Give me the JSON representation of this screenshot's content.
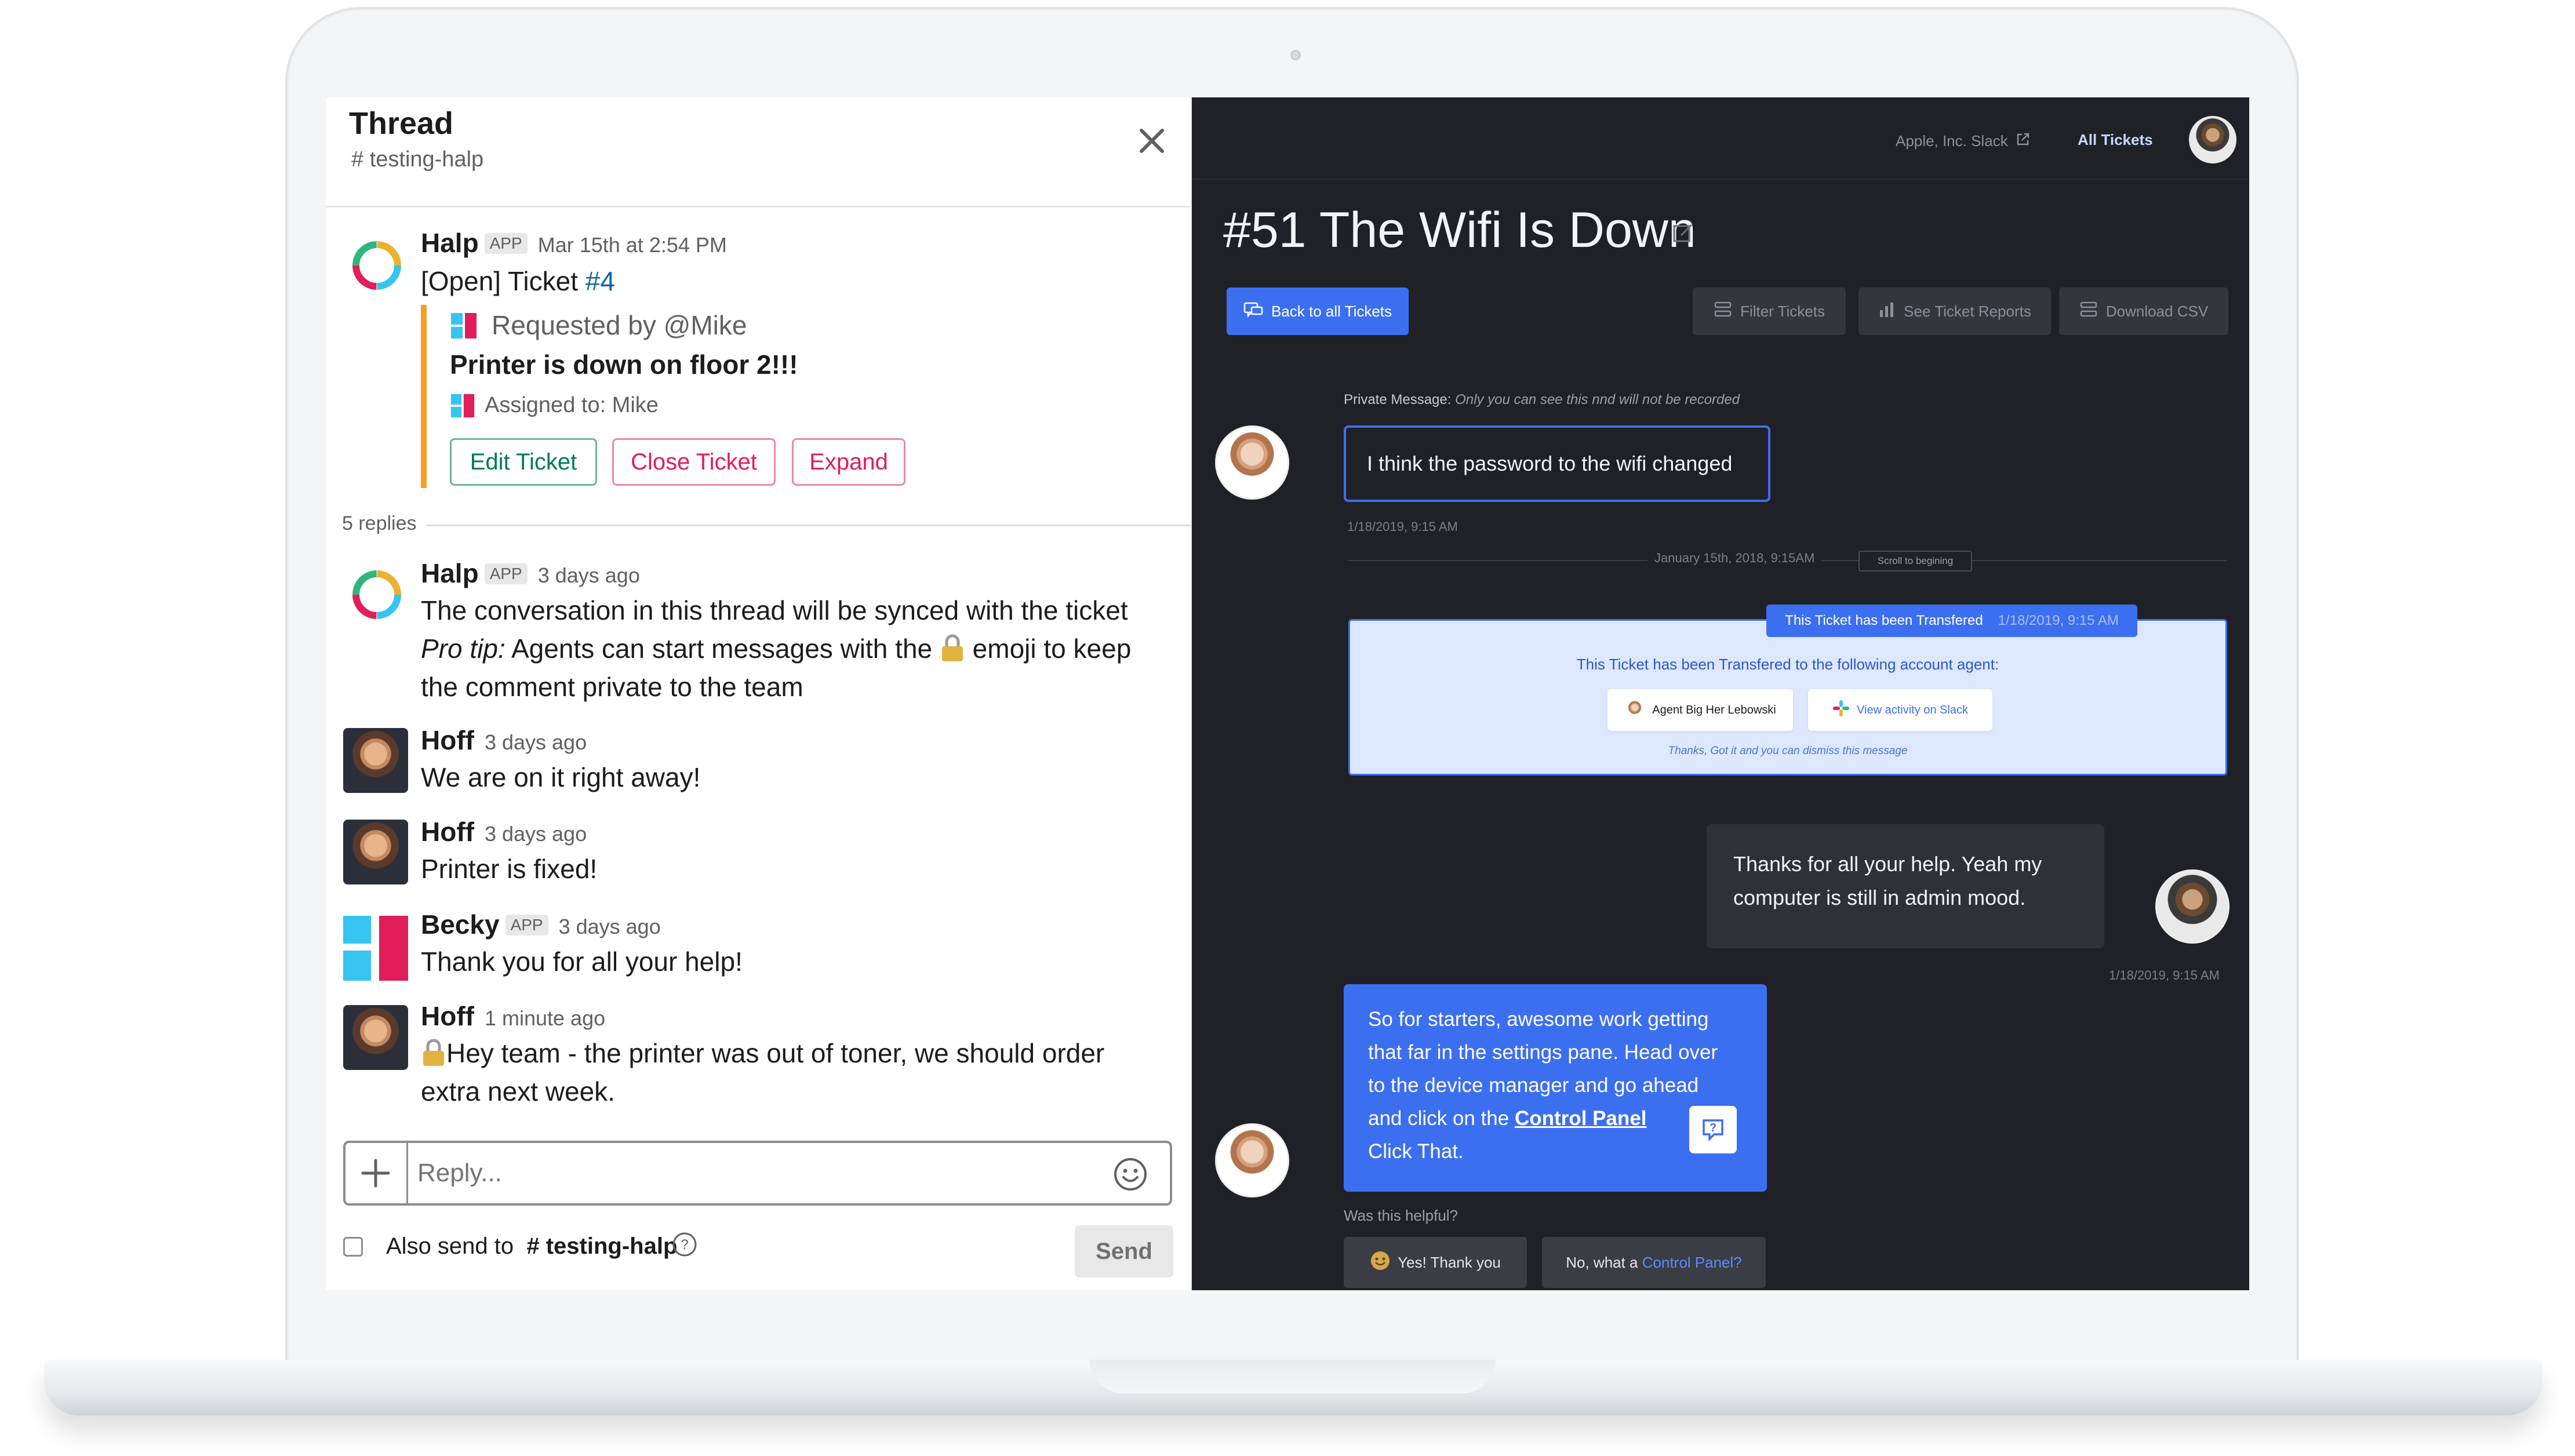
{
  "thread": {
    "title": "Thread",
    "channel": "# testing-halp",
    "parent": {
      "name": "Halp",
      "badge": "APP",
      "time": "Mar 15th at 2:54 PM",
      "line_prefix": "[Open] Ticket ",
      "ticket_link": "#4",
      "requested_by": "Requested by @Mike",
      "subject": "Printer is down on floor 2!!!",
      "assigned_to": "Assigned to: Mike",
      "buttons": {
        "edit": "Edit Ticket",
        "close": "Close Ticket",
        "expand": "Expand"
      }
    },
    "replies_count": "5 replies",
    "messages": [
      {
        "name": "Halp",
        "badge": "APP",
        "time": "3 days ago"
      },
      {
        "name": "Hoff",
        "time": "3 days ago",
        "text": "We are on it right away!"
      },
      {
        "name": "Hoff",
        "time": "3 days ago",
        "text": "Printer is fixed!"
      },
      {
        "name": "Becky",
        "badge": "APP",
        "time": "3 days ago",
        "text": "Thank you for all your help!"
      },
      {
        "name": "Hoff",
        "time": "1 minute ago",
        "line1": "Hey team - the printer was out of toner, we should order",
        "line2": "extra next week."
      }
    ],
    "halp_msg": {
      "line1": "The conversation in this thread will be synced with the ticket",
      "tip_label": "Pro tip:",
      "line2_a": " Agents can start messages with the ",
      "line2_b": " emoji to keep",
      "line3": "the comment private to the team"
    },
    "reply_placeholder": "Reply...",
    "also_send_label": "Also send to",
    "also_send_channel": "# testing-halp",
    "send_label": "Send"
  },
  "ticket": {
    "workspace_link": "Apple, Inc. Slack",
    "all_tickets": "All Tickets",
    "title": "#51 The Wifi Is Down",
    "back_button": "Back to all Tickets",
    "filter_button": "Filter Tickets",
    "reports_button": "See Ticket Reports",
    "csv_button": "Download CSV",
    "private_label": "Private Message:",
    "private_note": "Only you can see this nnd will not be recorded",
    "msg1": "I think the password to the wifi changed",
    "msg1_time": "1/18/2019, 9:15 AM",
    "divider_date": "January 15th, 2018, 9:15AM",
    "scroll_label": "Scroll to begining",
    "transfer_tab_label": "This Ticket has been Transfered",
    "transfer_tab_time": "1/18/2019, 9:15 AM",
    "transfer_text": "This Ticket has been Transfered to the following account agent:",
    "agent_chip": "Agent Big Her Lebowski",
    "slack_chip": "View activity on Slack",
    "dismiss_text": "Thanks, Got it and you can dismiss this message",
    "msg2_line1": "Thanks for all your help. Yeah my",
    "msg2_line2": "computer is still in admin mood.",
    "msg2_time": "1/18/2019, 9:15 AM",
    "msg3_line1": "So for starters, awesome work getting",
    "msg3_line2": "that far in the settings pane. Head over",
    "msg3_line3": "to the device manager and go ahead",
    "msg3_line4_a": "and click on the ",
    "msg3_link": "Control Panel",
    "msg3_line5": "Click That.",
    "helpful_q": "Was this helpful?",
    "yes_button": "Yes! Thank you",
    "no_button_a": "No, what a ",
    "no_button_link": "Control Panel?"
  },
  "colors": {
    "slack_green": "#007a5a",
    "slack_red": "#e01e5a",
    "halp_orange": "#f59f29",
    "accent_blue": "#3c6ff0",
    "dark_bg": "#1f2126"
  }
}
